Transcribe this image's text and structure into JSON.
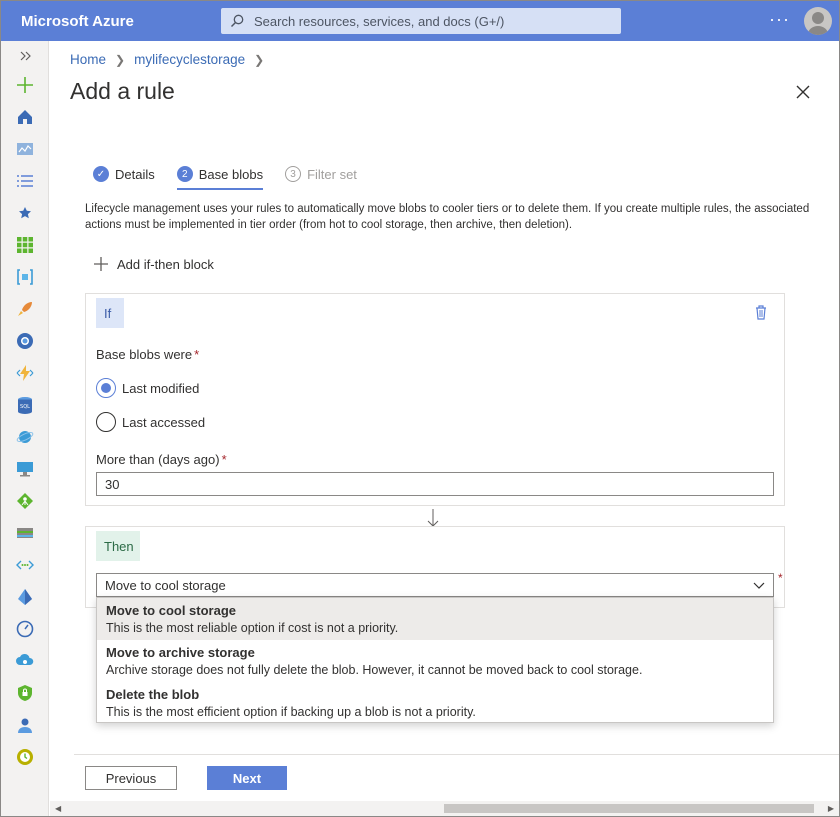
{
  "topbar": {
    "brand": "Microsoft Azure",
    "search_placeholder": "Search resources, services, and docs (G+/)",
    "more_label": "···"
  },
  "breadcrumb": {
    "items": [
      "Home",
      "mylifecyclestorage"
    ]
  },
  "page": {
    "title": "Add a rule"
  },
  "steps": [
    {
      "number": "✓",
      "label": "Details",
      "state": "done"
    },
    {
      "number": "2",
      "label": "Base blobs",
      "state": "active"
    },
    {
      "number": "3",
      "label": "Filter set",
      "state": "pending"
    }
  ],
  "description": "Lifecycle management uses your rules to automatically move blobs to cooler tiers or to delete them. If you create multiple rules, the associated actions must be implemented in tier order (from hot to cool storage, then archive, then deletion).",
  "add_block_label": "Add if-then block",
  "if_block": {
    "tag": "If",
    "base_blobs_label": "Base blobs were",
    "required_mark": "*",
    "radio_options": [
      {
        "label": "Last modified",
        "checked": true
      },
      {
        "label": "Last accessed",
        "checked": false
      }
    ],
    "days_label": "More than (days ago)",
    "days_value": "30"
  },
  "then_block": {
    "tag": "Then",
    "selected_value": "Move to cool storage",
    "required_mark": "*"
  },
  "dropdown": {
    "options": [
      {
        "title": "Move to cool storage",
        "detail": "This is the most reliable option if cost is not a priority."
      },
      {
        "title": "Move to archive storage",
        "detail": "Archive storage does not fully delete the blob. However, it cannot be moved back to cool storage."
      },
      {
        "title": "Delete the blob",
        "detail": "This is the most efficient option if backing up a blob is not a priority."
      }
    ]
  },
  "footer": {
    "previous_label": "Previous",
    "next_label": "Next"
  },
  "colors": {
    "accent": "#5b7fd6",
    "topbar": "#5b7fd6",
    "required": "#a4262c"
  },
  "leftnav_icons": [
    "expand-icon",
    "create-resource-icon",
    "home-icon",
    "dashboard-icon",
    "all-services-icon",
    "favorites-icon",
    "all-resources-icon",
    "resource-groups-icon",
    "quickstart-icon",
    "app-services-icon",
    "function-apps-icon",
    "sql-databases-icon",
    "cosmos-db-icon",
    "virtual-machines-icon",
    "load-balancers-icon",
    "storage-accounts-icon",
    "virtual-networks-icon",
    "azure-ad-icon",
    "monitor-icon",
    "advisor-icon",
    "security-center-icon",
    "cost-management-icon",
    "help-support-icon"
  ]
}
